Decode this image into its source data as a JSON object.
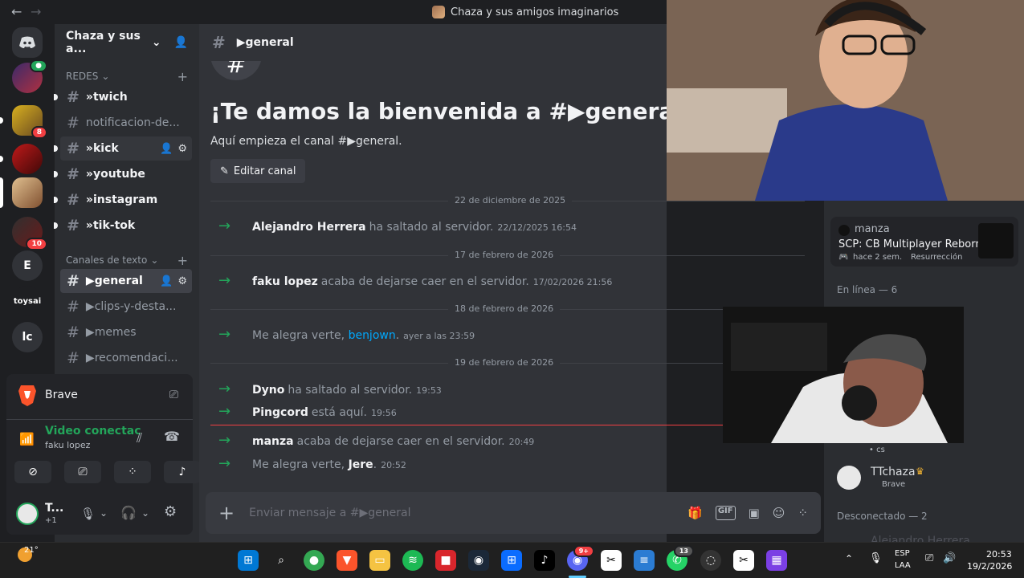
{
  "window": {
    "title": "Chaza y sus amigos imaginarios",
    "back": "←",
    "forward": "→"
  },
  "servers": [
    {
      "label": "",
      "badge": ""
    },
    {
      "label": "",
      "badge": "8"
    },
    {
      "label": "",
      "badge": ""
    },
    {
      "label": "",
      "badge": ""
    },
    {
      "label": "",
      "badge": "10"
    },
    {
      "label": "E",
      "badge": ""
    },
    {
      "label": "toysai",
      "badge": ""
    },
    {
      "label": "lc",
      "badge": ""
    }
  ],
  "sidebar": {
    "server_name": "Chaza y sus a...",
    "categories": [
      "REDES",
      "Canales de texto"
    ],
    "channels": [
      {
        "name": "»twich"
      },
      {
        "name": "notificacion-de..."
      },
      {
        "name": "»kick"
      },
      {
        "name": "»youtube"
      },
      {
        "name": "»instagram"
      },
      {
        "name": "»tik-tok"
      },
      {
        "name": "▶general"
      },
      {
        "name": "▶clips-y-desta..."
      },
      {
        "name": "▶memes"
      },
      {
        "name": "▶recomendaci..."
      }
    ]
  },
  "voice_panel": {
    "app": "Brave",
    "status": "Video conectac",
    "user": "faku lopez",
    "me_name": "T...",
    "me_sub": "+1"
  },
  "main": {
    "channel": "▶general",
    "welcome_title": "¡Te damos la bienvenida a #▶general!",
    "welcome_sub": "Aquí empieza el canal #▶general.",
    "edit_label": "Editar canal",
    "separators": [
      "22 de diciembre de 2025",
      "17 de febrero de 2026",
      "18 de febrero de 2026",
      "19 de febrero de 2026"
    ],
    "messages": [
      {
        "user": "Alejandro Herrera",
        "text": "ha saltado al servidor.",
        "time": "22/12/2025 16:54"
      },
      {
        "user": "faku lopez",
        "text": "acaba de dejarse caer en el servidor.",
        "time": "17/02/2026 21:56"
      },
      {
        "prefix": "Me alegra verte, ",
        "user": "benjown",
        "suffix": ".",
        "time": "ayer a las 23:59"
      },
      {
        "user": "Dyno",
        "text": "ha saltado al servidor.",
        "time": "19:53"
      },
      {
        "user": "Pingcord",
        "text": "está aquí.",
        "time": "19:56"
      },
      {
        "user": "manza",
        "text": "acaba de dejarse caer en el servidor.",
        "time": "20:49"
      },
      {
        "prefix": "Me alegra verte, ",
        "user": "Jere",
        "suffix": ".",
        "time": "20:52"
      }
    ],
    "composer_placeholder": "Enviar mensaje a #▶general"
  },
  "members": {
    "activity": {
      "name": "manza",
      "game": "SCP: CB Multiplayer Reborn",
      "when": "hace 2 sem.",
      "tag": "Resurrección"
    },
    "online_header": "En línea — 6",
    "cs": "• cs",
    "ttchaza": {
      "name": "TTchaza",
      "sub": "Brave"
    },
    "offline_header": "Desconectado — 2",
    "offline_first": "Alejandro Herrera"
  },
  "taskbar": {
    "weather": "21°",
    "lang": "ESP",
    "layout": "LAA",
    "time": "20:53",
    "date": "19/2/2026",
    "discord_badge": "9+",
    "whatsapp_badge": "13"
  },
  "colors": {
    "accent": "#5865f2",
    "online": "#23a55a",
    "danger": "#f23f42",
    "mention": "#00a8fc"
  }
}
